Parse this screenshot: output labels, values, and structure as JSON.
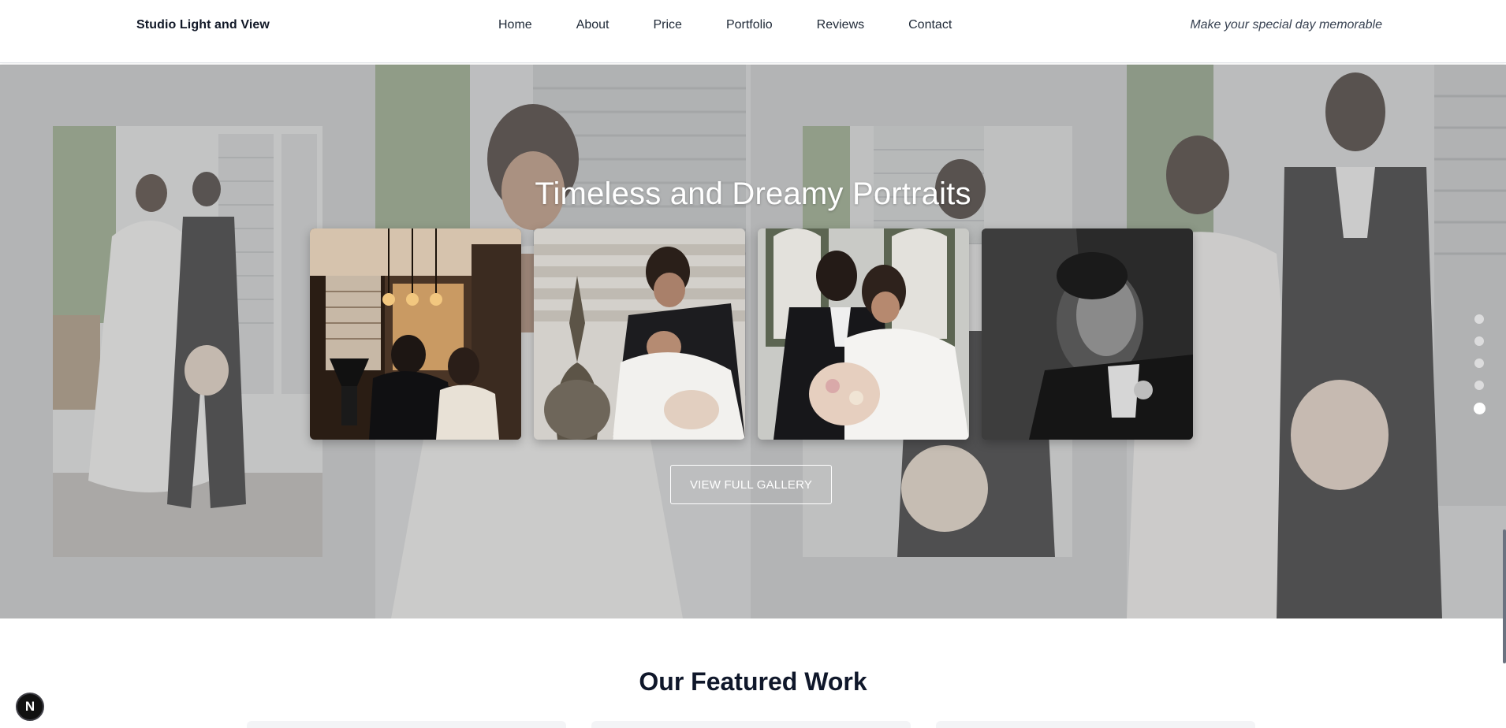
{
  "header": {
    "brand": "Studio Light and View",
    "nav": [
      "Home",
      "About",
      "Price",
      "Portfolio",
      "Reviews",
      "Contact"
    ],
    "tagline": "Make your special day memorable"
  },
  "hero": {
    "title": "Timeless and Dreamy Portraits",
    "gallery_button": "VIEW FULL GALLERY",
    "slide_count": 5,
    "active_slide": 5
  },
  "featured": {
    "title": "Our Featured Work"
  },
  "badge": {
    "letter": "N"
  }
}
